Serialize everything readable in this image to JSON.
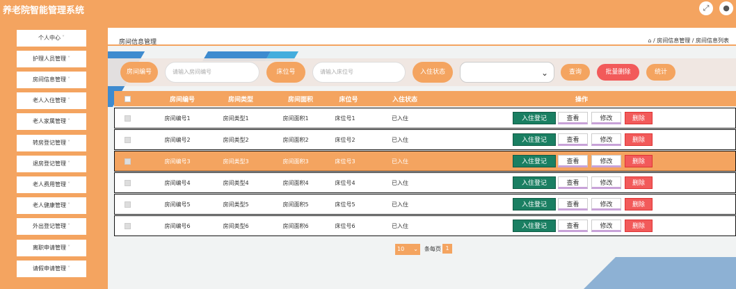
{
  "app": {
    "title": "养老院智能管理系统",
    "fullscreen_icon": "expand-icon",
    "user_icon": "user-icon"
  },
  "colors": {
    "accent": "#f4a460",
    "checkin": "#1a7f62",
    "delete": "#f25a5a",
    "stripe": "#1f78c8"
  },
  "sidebar": {
    "items": [
      {
        "label": "个人中心"
      },
      {
        "label": "护理人员管理"
      },
      {
        "label": "房间信息管理"
      },
      {
        "label": "老人入住管理"
      },
      {
        "label": "老人家属管理"
      },
      {
        "label": "转房登记管理"
      },
      {
        "label": "退房登记管理"
      },
      {
        "label": "老人费用管理"
      },
      {
        "label": "老人健康管理"
      },
      {
        "label": "外出登记管理"
      },
      {
        "label": "离职申请管理"
      },
      {
        "label": "请假申请管理"
      }
    ]
  },
  "header": {
    "title": "房间信息管理",
    "home_icon": "home-icon",
    "breadcrumb": "/ 房间信息管理 / 房间信息列表"
  },
  "search": {
    "room_no_label": "房间编号",
    "room_no_placeholder": "请输入房间编号",
    "bed_no_label": "床位号",
    "bed_no_placeholder": "请输入床位号",
    "status_label": "入住状态",
    "status_value": "",
    "query_btn": "查询",
    "batch_delete_btn": "批量删除",
    "stats_btn": "统计"
  },
  "table": {
    "columns": [
      "房间编号",
      "房间类型",
      "房间面积",
      "床位号",
      "入住状态",
      "操作"
    ],
    "actions": {
      "checkin": "入住登记",
      "view": "查看",
      "edit": "修改",
      "delete": "删除"
    },
    "rows": [
      {
        "room_no": "房间编号1",
        "room_type": "房间类型1",
        "area": "房间面积1",
        "bed_no": "床位号1",
        "status": "已入住"
      },
      {
        "room_no": "房间编号2",
        "room_type": "房间类型2",
        "area": "房间面积2",
        "bed_no": "床位号2",
        "status": "已入住"
      },
      {
        "room_no": "房间编号3",
        "room_type": "房间类型3",
        "area": "房间面积3",
        "bed_no": "床位号3",
        "status": "已入住",
        "highlighted": true
      },
      {
        "room_no": "房间编号4",
        "room_type": "房间类型4",
        "area": "房间面积4",
        "bed_no": "床位号4",
        "status": "已入住"
      },
      {
        "room_no": "房间编号5",
        "room_type": "房间类型5",
        "area": "房间面积5",
        "bed_no": "床位号5",
        "status": "已入住"
      },
      {
        "room_no": "房间编号6",
        "room_type": "房间类型6",
        "area": "房间面积6",
        "bed_no": "床位号6",
        "status": "已入住"
      }
    ]
  },
  "pagination": {
    "page_size": "10",
    "per_page_label": "条每页",
    "current_page": "1"
  }
}
